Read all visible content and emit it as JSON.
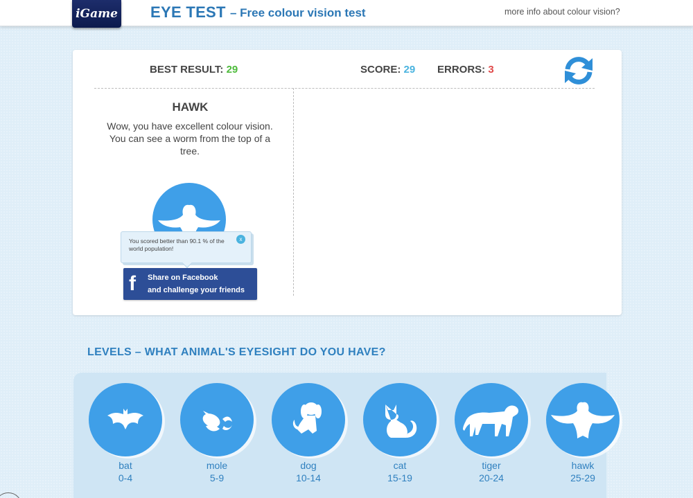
{
  "header": {
    "logo_text": "iGame",
    "title": "EYE TEST",
    "subtitle": "– Free colour vision test",
    "info_link": "more info about colour vision?"
  },
  "stats": {
    "best_label": "BEST RESULT:",
    "best_value": "29",
    "score_label": "SCORE:",
    "score_value": "29",
    "errors_label": "ERRORS:",
    "errors_value": "3"
  },
  "result": {
    "animal": "HAWK",
    "description": "Wow, you have excellent colour vision. You can see a worm from the top of a tree."
  },
  "tooltip": {
    "text": "You scored better than 90.1 % of the world population!",
    "close": "x"
  },
  "facebook": {
    "icon": "f",
    "line1": "Share on Facebook",
    "line2": "and challenge your friends"
  },
  "levels": {
    "heading": "LEVELS – WHAT ANIMAL'S EYESIGHT DO YOU HAVE?",
    "items": [
      {
        "name": "bat",
        "range": "0-4",
        "icon": "bat-icon"
      },
      {
        "name": "mole",
        "range": "5-9",
        "icon": "mole-icon"
      },
      {
        "name": "dog",
        "range": "10-14",
        "icon": "dog-icon"
      },
      {
        "name": "cat",
        "range": "15-19",
        "icon": "cat-icon"
      },
      {
        "name": "tiger",
        "range": "20-24",
        "icon": "tiger-icon"
      },
      {
        "name": "hawk",
        "range": "25-29",
        "icon": "hawk-icon"
      }
    ]
  },
  "colors": {
    "accent": "#2b77b5",
    "circle": "#3f9fe8",
    "best": "#4dbb3b",
    "score": "#4ab3df",
    "errors": "#e04a4a",
    "facebook": "#2d4e97"
  }
}
